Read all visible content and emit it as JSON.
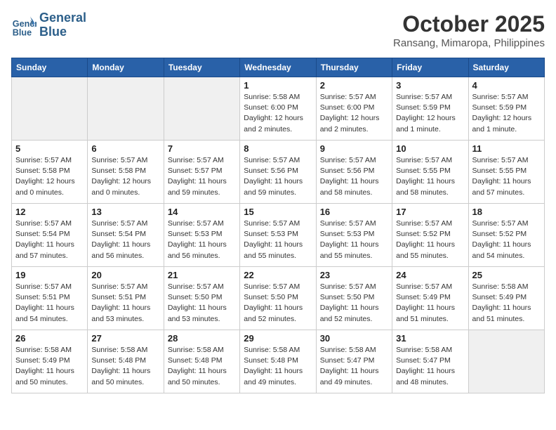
{
  "header": {
    "logo_line1": "General",
    "logo_line2": "Blue",
    "month": "October 2025",
    "location": "Ransang, Mimaropa, Philippines"
  },
  "days_of_week": [
    "Sunday",
    "Monday",
    "Tuesday",
    "Wednesday",
    "Thursday",
    "Friday",
    "Saturday"
  ],
  "weeks": [
    [
      {
        "day": "",
        "info": ""
      },
      {
        "day": "",
        "info": ""
      },
      {
        "day": "",
        "info": ""
      },
      {
        "day": "1",
        "info": "Sunrise: 5:58 AM\nSunset: 6:00 PM\nDaylight: 12 hours\nand 2 minutes."
      },
      {
        "day": "2",
        "info": "Sunrise: 5:57 AM\nSunset: 6:00 PM\nDaylight: 12 hours\nand 2 minutes."
      },
      {
        "day": "3",
        "info": "Sunrise: 5:57 AM\nSunset: 5:59 PM\nDaylight: 12 hours\nand 1 minute."
      },
      {
        "day": "4",
        "info": "Sunrise: 5:57 AM\nSunset: 5:59 PM\nDaylight: 12 hours\nand 1 minute."
      }
    ],
    [
      {
        "day": "5",
        "info": "Sunrise: 5:57 AM\nSunset: 5:58 PM\nDaylight: 12 hours\nand 0 minutes."
      },
      {
        "day": "6",
        "info": "Sunrise: 5:57 AM\nSunset: 5:58 PM\nDaylight: 12 hours\nand 0 minutes."
      },
      {
        "day": "7",
        "info": "Sunrise: 5:57 AM\nSunset: 5:57 PM\nDaylight: 11 hours\nand 59 minutes."
      },
      {
        "day": "8",
        "info": "Sunrise: 5:57 AM\nSunset: 5:56 PM\nDaylight: 11 hours\nand 59 minutes."
      },
      {
        "day": "9",
        "info": "Sunrise: 5:57 AM\nSunset: 5:56 PM\nDaylight: 11 hours\nand 58 minutes."
      },
      {
        "day": "10",
        "info": "Sunrise: 5:57 AM\nSunset: 5:55 PM\nDaylight: 11 hours\nand 58 minutes."
      },
      {
        "day": "11",
        "info": "Sunrise: 5:57 AM\nSunset: 5:55 PM\nDaylight: 11 hours\nand 57 minutes."
      }
    ],
    [
      {
        "day": "12",
        "info": "Sunrise: 5:57 AM\nSunset: 5:54 PM\nDaylight: 11 hours\nand 57 minutes."
      },
      {
        "day": "13",
        "info": "Sunrise: 5:57 AM\nSunset: 5:54 PM\nDaylight: 11 hours\nand 56 minutes."
      },
      {
        "day": "14",
        "info": "Sunrise: 5:57 AM\nSunset: 5:53 PM\nDaylight: 11 hours\nand 56 minutes."
      },
      {
        "day": "15",
        "info": "Sunrise: 5:57 AM\nSunset: 5:53 PM\nDaylight: 11 hours\nand 55 minutes."
      },
      {
        "day": "16",
        "info": "Sunrise: 5:57 AM\nSunset: 5:53 PM\nDaylight: 11 hours\nand 55 minutes."
      },
      {
        "day": "17",
        "info": "Sunrise: 5:57 AM\nSunset: 5:52 PM\nDaylight: 11 hours\nand 55 minutes."
      },
      {
        "day": "18",
        "info": "Sunrise: 5:57 AM\nSunset: 5:52 PM\nDaylight: 11 hours\nand 54 minutes."
      }
    ],
    [
      {
        "day": "19",
        "info": "Sunrise: 5:57 AM\nSunset: 5:51 PM\nDaylight: 11 hours\nand 54 minutes."
      },
      {
        "day": "20",
        "info": "Sunrise: 5:57 AM\nSunset: 5:51 PM\nDaylight: 11 hours\nand 53 minutes."
      },
      {
        "day": "21",
        "info": "Sunrise: 5:57 AM\nSunset: 5:50 PM\nDaylight: 11 hours\nand 53 minutes."
      },
      {
        "day": "22",
        "info": "Sunrise: 5:57 AM\nSunset: 5:50 PM\nDaylight: 11 hours\nand 52 minutes."
      },
      {
        "day": "23",
        "info": "Sunrise: 5:57 AM\nSunset: 5:50 PM\nDaylight: 11 hours\nand 52 minutes."
      },
      {
        "day": "24",
        "info": "Sunrise: 5:57 AM\nSunset: 5:49 PM\nDaylight: 11 hours\nand 51 minutes."
      },
      {
        "day": "25",
        "info": "Sunrise: 5:58 AM\nSunset: 5:49 PM\nDaylight: 11 hours\nand 51 minutes."
      }
    ],
    [
      {
        "day": "26",
        "info": "Sunrise: 5:58 AM\nSunset: 5:49 PM\nDaylight: 11 hours\nand 50 minutes."
      },
      {
        "day": "27",
        "info": "Sunrise: 5:58 AM\nSunset: 5:48 PM\nDaylight: 11 hours\nand 50 minutes."
      },
      {
        "day": "28",
        "info": "Sunrise: 5:58 AM\nSunset: 5:48 PM\nDaylight: 11 hours\nand 50 minutes."
      },
      {
        "day": "29",
        "info": "Sunrise: 5:58 AM\nSunset: 5:48 PM\nDaylight: 11 hours\nand 49 minutes."
      },
      {
        "day": "30",
        "info": "Sunrise: 5:58 AM\nSunset: 5:47 PM\nDaylight: 11 hours\nand 49 minutes."
      },
      {
        "day": "31",
        "info": "Sunrise: 5:58 AM\nSunset: 5:47 PM\nDaylight: 11 hours\nand 48 minutes."
      },
      {
        "day": "",
        "info": ""
      }
    ]
  ]
}
